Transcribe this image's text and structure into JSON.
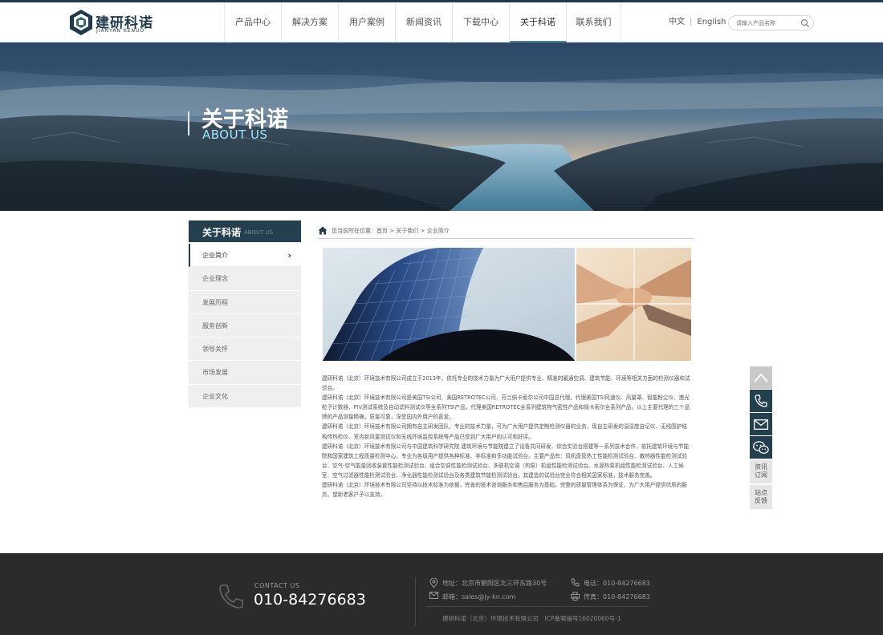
{
  "header": {
    "logo_cn": "建研科诺",
    "logo_en": "JIANYAN KENUO",
    "nav": [
      {
        "label": "产品中心",
        "active": false
      },
      {
        "label": "解决方案",
        "active": false
      },
      {
        "label": "用户案例",
        "active": false
      },
      {
        "label": "新闻资讯",
        "active": false
      },
      {
        "label": "下载中心",
        "active": false
      },
      {
        "label": "关于科诺",
        "active": true
      },
      {
        "label": "联系我们",
        "active": false
      }
    ],
    "lang_cn": "中文",
    "lang_sep": "|",
    "lang_en": "English",
    "search_placeholder": "请输入产品名称"
  },
  "banner": {
    "title": "关于科诺",
    "subtitle": "ABOUT US"
  },
  "sidebar": {
    "title_cn": "关于科诺",
    "title_en": "ABOUT US",
    "items": [
      {
        "label": "企业简介",
        "active": true
      },
      {
        "label": "企业理念",
        "active": false
      },
      {
        "label": "发展历程",
        "active": false
      },
      {
        "label": "服务创新",
        "active": false
      },
      {
        "label": "领导关怀",
        "active": false
      },
      {
        "label": "市场发展",
        "active": false
      },
      {
        "label": "企业文化",
        "active": false
      }
    ],
    "chevron": "›"
  },
  "breadcrumb": "您当前所在位置：首页 > 关于我们 > 企业简介",
  "article": [
    "建研科诺（北京）环境技术有限公司成立于2013年，依托专业的技术力量为广大用户提供专业、精准的暖通空调、建筑节能、环境等相关方面的检测仪器和试验台。",
    "建研科诺（北京）环境技术有限公司是美国TSI公司、美国RETROTEC公司、芬兰佩卡索尔公司中国总代理。代理美国TSI风速仪、风量罩、智能粉尘仪、激光粒子计数器、PIV测试系统及自动滤料测试仪等全系列TSI产品，代理美国RETROTEC全系列建筑物气密性产品和佩卡索尔全系列产品。以上主要代理的三个品牌的产品测量精确，质量可靠，深受国内外用户的喜爱。",
    "建研科诺（北京）环境技术有限公司拥有自主研发团队，专业的技术力量，可为广大用户提供定制检测仪器的业务，现自主研发的温湿度自记仪、无线围护结构传热检仪、室内新风量测试仪和无线环境监控系统等产品已受到广大用户的认可和好评。",
    "建研科诺（北京）环境技术有限公司与中国建筑科学研究院 建筑环境与节能院建立了设备共同研发、综合实验台搭建等一系列技术合作，依托建筑环境与节能院和国家建筑工程质量检测中心，专业为各级用户提供各种标准、非标准和多功能试验台。主要产品有：风机盘管热工性能检测试验台、散热器性能检测试验台、空气-空气能量回收装置性能检测试验台、组合空调性能检测试验台、多联机空调（热泵）机组性能检测试验台、水源热泵机组性能检测试验台、人工候室、空气过滤器性能检测试验台、净化器性能检测试验台及各类建筑节能检测试验台。其建造的试验台完全符合相关国家标准，技术服务完善。",
    "建研科诺（北京）环境技术有限公司坚持以技术标准为依据，完善的技术咨询服务和售后服务为基础，完整的质量管理体系为保证，为广大用户提供优质的服务。望新老客户予以支持。"
  ],
  "float_bar": {
    "subscribe": "资讯订阅",
    "feedback": "站点反馈"
  },
  "footer": {
    "contact_label": "CONTACT US",
    "contact_phone": "010-84276683",
    "address": "地址：北京市朝阳区北三环东路30号",
    "tel": "电话：010-84276683",
    "email": "邮箱：sales@jy-kn.com",
    "fax": "传真：010-84276683",
    "copyright": "建研科诺（北京）环境技术有限公司　ICP备案编号16020060号-1"
  },
  "colors": {
    "brand_dark": "#24404e",
    "accent": "#4a8594",
    "banner_sub": "#9fe3ff",
    "footer_bg": "#2b2b2b"
  }
}
